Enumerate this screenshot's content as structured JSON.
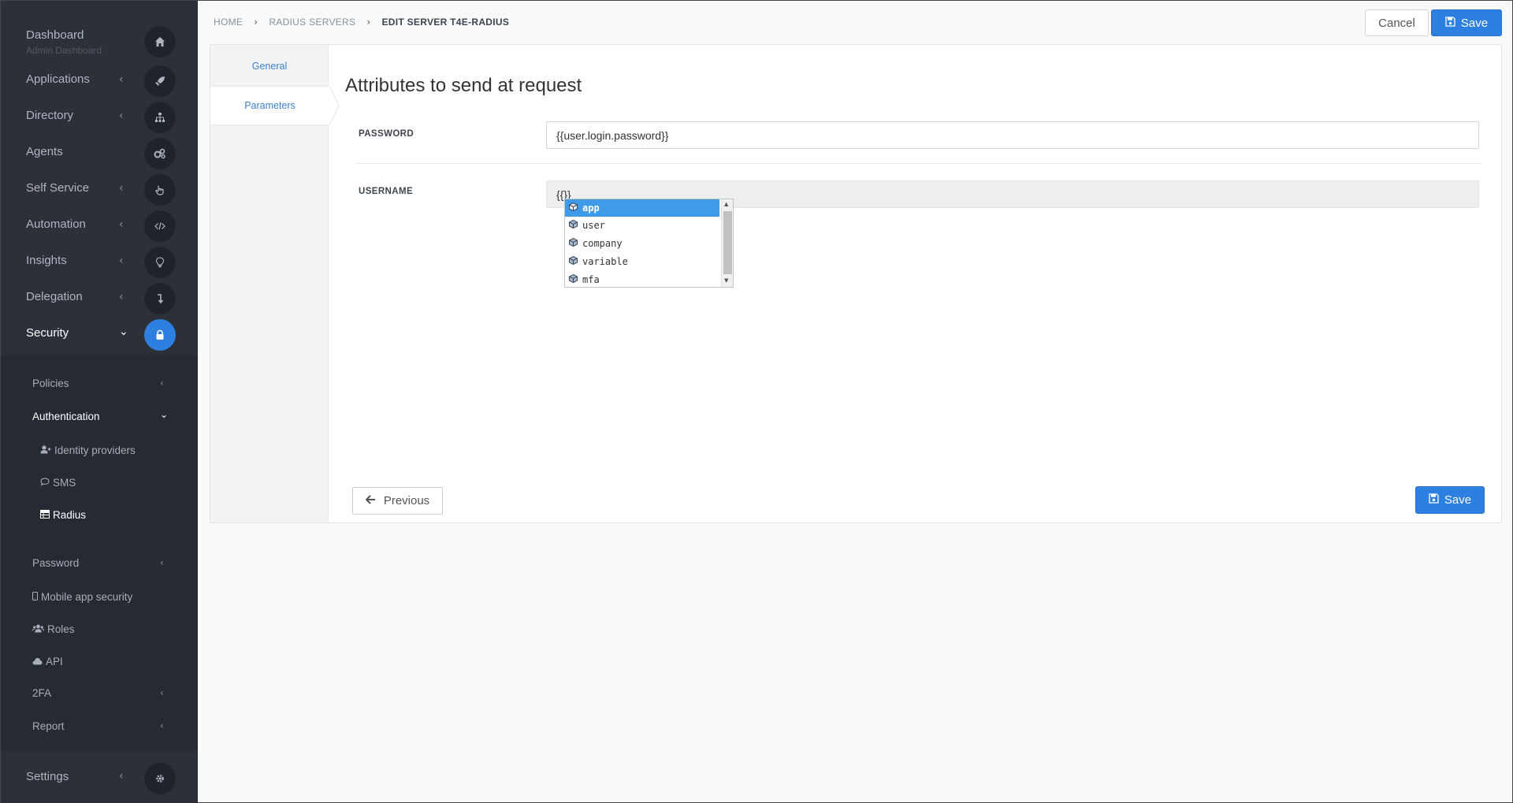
{
  "breadcrumb": {
    "items": [
      "HOME",
      "RADIUS SERVERS"
    ],
    "current": "EDIT SERVER T4E-RADIUS"
  },
  "header": {
    "cancel_label": "Cancel",
    "save_label": "Save"
  },
  "sidebar": {
    "dashboard": {
      "label": "Dashboard",
      "sublabel": "Admin Dashboard"
    },
    "items": [
      {
        "label": "Applications",
        "icon": "rocket-icon"
      },
      {
        "label": "Directory",
        "icon": "sitemap-icon"
      },
      {
        "label": "Agents",
        "icon": "cogs-icon"
      },
      {
        "label": "Self Service",
        "icon": "hand-pointer-icon"
      },
      {
        "label": "Automation",
        "icon": "code-icon"
      },
      {
        "label": "Insights",
        "icon": "lightbulb-icon"
      },
      {
        "label": "Delegation",
        "icon": "level-down-icon"
      },
      {
        "label": "Security",
        "icon": "lock-icon",
        "active": true
      }
    ],
    "security_sub": {
      "policies": "Policies",
      "authentication": "Authentication",
      "auth_children": [
        "Identity providers",
        "SMS",
        "Radius"
      ],
      "password": "Password",
      "mobile_app_security": "Mobile app security",
      "roles": "Roles",
      "api": "API",
      "twofa": "2FA",
      "report": "Report"
    },
    "settings": {
      "label": "Settings",
      "icon": "gear-icon"
    }
  },
  "tabs": {
    "general": "General",
    "parameters": "Parameters"
  },
  "main": {
    "heading": "Attributes to send at request",
    "password_label": "PASSWORD",
    "password_value": "{{user.login.password}}",
    "username_label": "USERNAME",
    "username_value": "{{}}",
    "autocomplete": [
      "app",
      "user",
      "company",
      "variable",
      "mfa"
    ],
    "previous_label": "Previous",
    "save_label": "Save"
  },
  "colors": {
    "accent": "#2d7fe0",
    "sidebar": "#2b3039",
    "autocomplete_selected": "#3f9ae8"
  }
}
